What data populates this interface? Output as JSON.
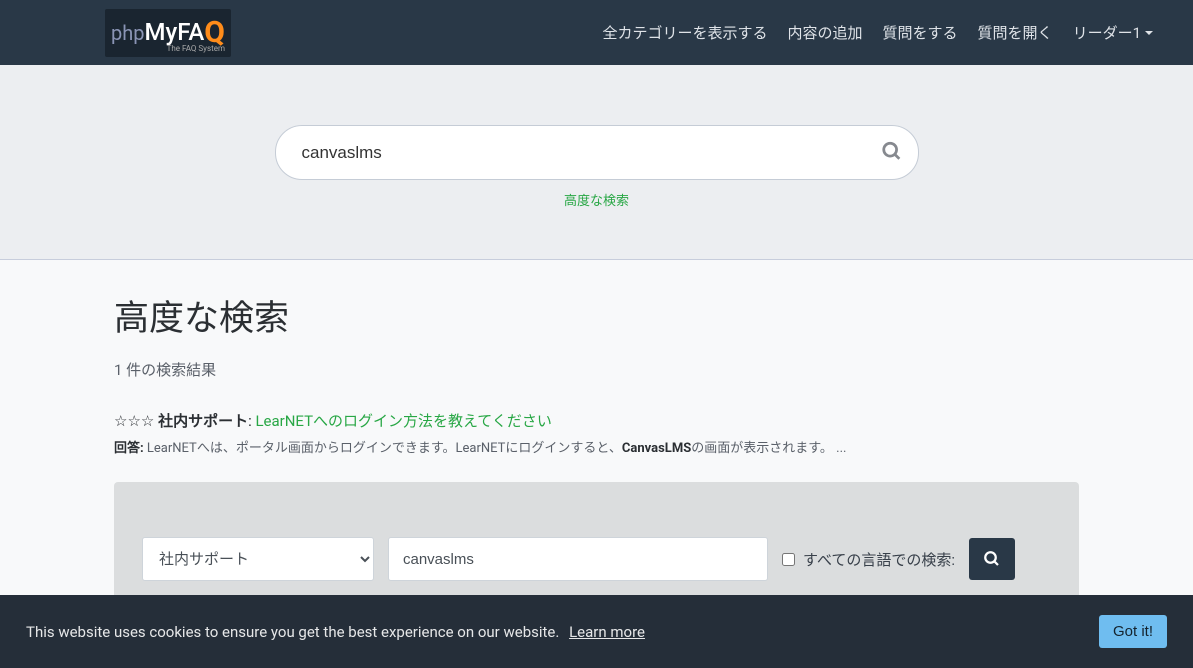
{
  "nav": {
    "items": [
      "全カテゴリーを表示する",
      "内容の追加",
      "質問をする",
      "質問を開く"
    ],
    "user": "リーダー1"
  },
  "search": {
    "value": "canvaslms",
    "advanced_label": "高度な検索"
  },
  "page": {
    "title": "高度な検索",
    "result_count": "1 件の検索結果"
  },
  "result": {
    "stars": "☆☆☆",
    "category": "社内サポート",
    "link_text": "LearNETへのログイン方法を教えてください",
    "answer_label": "回答:",
    "answer_pre": " LearNETへは、ポータル画面からログインできます。LearNETにログインすると、",
    "answer_bold": "CanvasLMS",
    "answer_post": "の画面が表示されます。 ..."
  },
  "panel": {
    "select_value": "社内サポート",
    "input_value": "canvaslms",
    "all_lang_label": "すべての言語での検索:"
  },
  "cookie": {
    "text": "This website uses cookies to ensure you get the best experience on our website.",
    "learn": "Learn more",
    "gotit": "Got it!"
  },
  "logo": {
    "php": "php",
    "my": "My",
    "fa": "FA",
    "q": "Q",
    "sub": "The FAQ System"
  }
}
